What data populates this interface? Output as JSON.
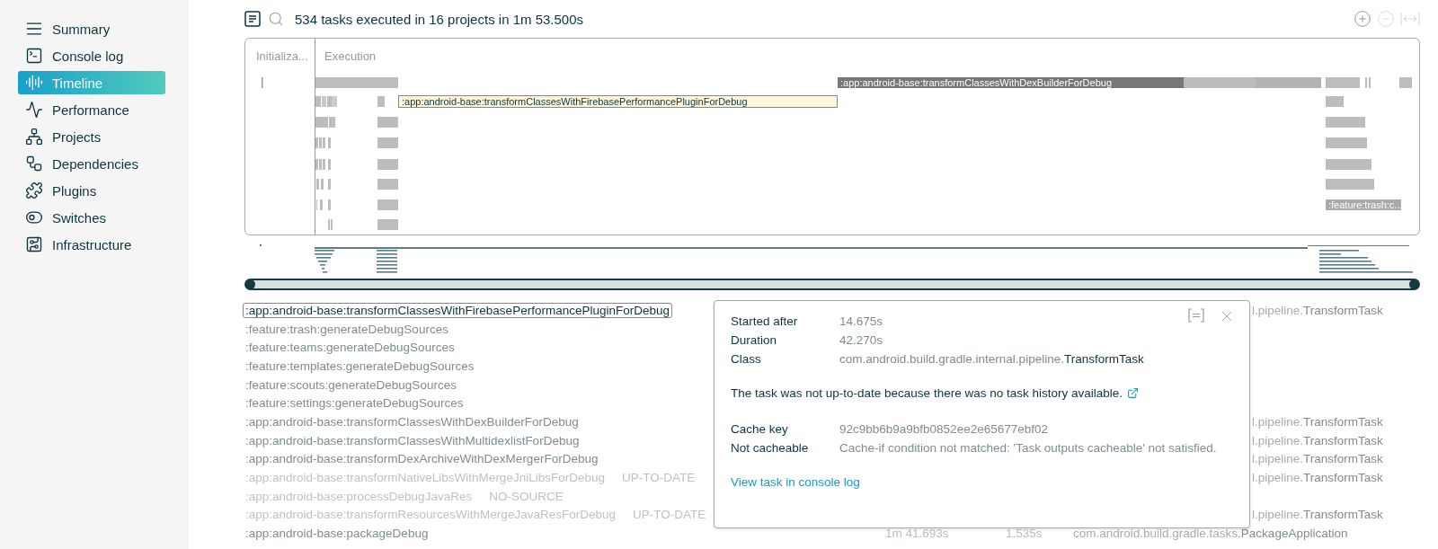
{
  "sidebar": {
    "items": [
      {
        "label": "Summary",
        "selected": false
      },
      {
        "label": "Console log",
        "selected": false
      },
      {
        "label": "Timeline",
        "selected": true
      },
      {
        "label": "Performance",
        "selected": false
      },
      {
        "label": "Projects",
        "selected": false
      },
      {
        "label": "Dependencies",
        "selected": false
      },
      {
        "label": "Plugins",
        "selected": false
      },
      {
        "label": "Switches",
        "selected": false
      },
      {
        "label": "Infrastructure",
        "selected": false
      }
    ]
  },
  "header": {
    "summary": "534 tasks executed in 16 projects in 1m 53.500s"
  },
  "range_slider": {
    "level": 1
  },
  "timeline": {
    "phases": [
      "Initializa...",
      "Execution"
    ],
    "bars": [
      {
        "label": ":app:android-base:transformClassesWithDexBuilderForDebug",
        "kind": "hovered"
      },
      {
        "label": ":app:android-base:transformClassesWithFirebasePerformancePluginForDebug",
        "kind": "selected"
      },
      {
        "label": ":feature:trash:c...",
        "kind": "plain"
      }
    ]
  },
  "tasks": [
    {
      "name": ":app:android-base:transformClassesWithFirebasePerformancePluginForDebug",
      "selected": true,
      "skipped": false,
      "class_prefix": "l.pipeline.",
      "class_name": "TransformTask"
    },
    {
      "name": ":feature:trash:generateDebugSources",
      "selected": false,
      "skipped": false
    },
    {
      "name": ":feature:teams:generateDebugSources",
      "selected": false,
      "skipped": false
    },
    {
      "name": ":feature:templates:generateDebugSources",
      "selected": false,
      "skipped": false
    },
    {
      "name": ":feature:scouts:generateDebugSources",
      "selected": false,
      "skipped": false
    },
    {
      "name": ":feature:settings:generateDebugSources",
      "selected": false,
      "skipped": false
    },
    {
      "name": ":app:android-base:transformClassesWithDexBuilderForDebug",
      "selected": false,
      "skipped": false,
      "class_prefix": "l.pipeline.",
      "class_name": "TransformTask"
    },
    {
      "name": ":app:android-base:transformClassesWithMultidexlistForDebug",
      "selected": false,
      "skipped": false,
      "class_prefix": "l.pipeline.",
      "class_name": "TransformTask"
    },
    {
      "name": ":app:android-base:transformDexArchiveWithDexMergerForDebug",
      "selected": false,
      "skipped": false,
      "class_prefix": "l.pipeline.",
      "class_name": "TransformTask"
    },
    {
      "name": ":app:android-base:transformNativeLibsWithMergeJniLibsForDebug",
      "status": "UP-TO-DATE",
      "selected": false,
      "skipped": true,
      "class_prefix": "l.pipeline.",
      "class_name": "TransformTask"
    },
    {
      "name": ":app:android-base:processDebugJavaRes",
      "status": "NO-SOURCE",
      "selected": false,
      "skipped": true
    },
    {
      "name": ":app:android-base:transformResourcesWithMergeJavaResForDebug",
      "status": "UP-TO-DATE",
      "selected": false,
      "skipped": true,
      "class_prefix": "l.pipeline.",
      "class_name": "TransformTask"
    },
    {
      "name": ":app:android-base:packageDebug",
      "selected": false,
      "skipped": false,
      "start": "1m 41.693s",
      "duration": "1.535s",
      "class_prefix": "com.android.build.gradle.tasks.",
      "class_name": "PackageApplication"
    }
  ],
  "details": {
    "fields": [
      {
        "label": "Started after",
        "value": "14.675s"
      },
      {
        "label": "Duration",
        "value": "42.270s"
      },
      {
        "label": "Class",
        "value_prefix": "com.android.build.gradle.internal.pipeline.",
        "value": "TransformTask"
      }
    ],
    "reason": "The task was not up-to-date because there was no task history available.",
    "cache_fields": [
      {
        "label": "Cache key",
        "value": "92c9bb6b9a9bfb0852ee2e65677ebf02"
      },
      {
        "label": "Not cacheable",
        "value": "Cache-if condition not matched: 'Task outputs cacheable' not satisfied."
      }
    ],
    "link": "View task in console log"
  }
}
